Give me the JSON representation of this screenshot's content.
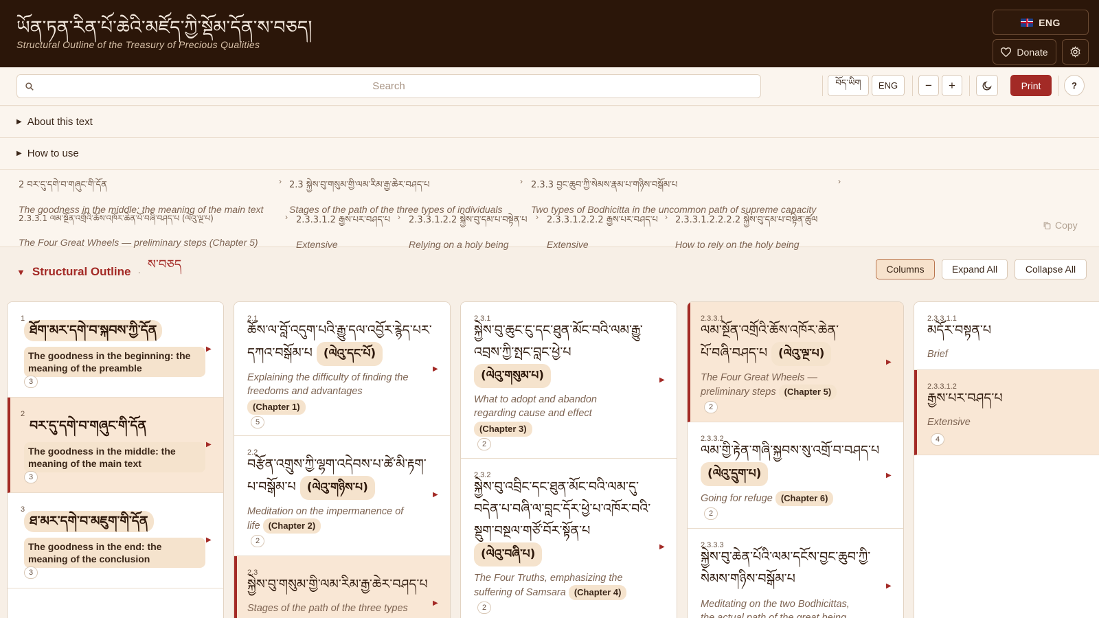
{
  "header": {
    "title_tibetan": "ཡོན་ཏན་རིན་པོ་ཆེའི་མཛོད་ཀྱི་སྡོམ་དོན་ས་བཅད།",
    "subtitle": "Structural Outline of the Treasury of Precious Qualities",
    "lang_button": "ENG",
    "donate_label": "Donate",
    "flag_icon": "uk-flag-icon"
  },
  "toolbar": {
    "search_placeholder": "Search",
    "tibetan_btn": "བོད་ཡིག",
    "english_btn": "ENG",
    "zoom_out": "−",
    "zoom_in": "+",
    "print": "Print",
    "help": "?"
  },
  "accordions": {
    "about": "About this text",
    "how_to_use": "How to use"
  },
  "breadcrumb": {
    "row1": [
      {
        "tib": "2 བར་དུ་དགེ་བ་གཞུང་གི་དོན",
        "eng": "The goodness in the middle: the meaning of the main text"
      },
      {
        "tib": "2.3 སྐྱེས་བུ་གསུམ་གྱི་ལམ་རིམ་རྒྱ་ཆེར་བཤད་པ",
        "eng": "Stages of the path of the three types of individuals"
      },
      {
        "tib": "2.3.3 བྱང་ཆུབ་ཀྱི་སེམས་རྣམ་པ་གཉིས་བསྒོམ་པ",
        "eng": "Two types of Bodhicitta in the uncommon path of supreme capacity"
      }
    ],
    "row2": [
      {
        "tib": "2.3.3.1 ལམ་སྔོན་འགྲོའི་ཆོས་འཁོར་ཆེན་པོ་བཞི་བཤད་པ (ལེའུ་ལྔ་པ)",
        "eng": "The Four Great Wheels — preliminary steps (Chapter 5)"
      },
      {
        "tib": "2.3.3.1.2 རྒྱས་པར་བཤད་པ",
        "eng": "Extensive"
      },
      {
        "tib": "2.3.3.1.2.2 སྐྱེས་བུ་དམ་པ་བསྟེན་པ",
        "eng": "Relying on a holy being"
      },
      {
        "tib": "2.3.3.1.2.2.2 རྒྱས་པར་བཤད་པ",
        "eng": "Extensive"
      },
      {
        "tib": "2.3.3.1.2.2.2.2 སྐྱེས་བུ་དམ་པ་བསྟེན་ཚུལ",
        "eng": "How to rely on the holy being"
      }
    ],
    "copy": "Copy"
  },
  "section": {
    "title": "Structural Outline",
    "tibetan": "ས་བཅད",
    "columns_btn": "Columns",
    "expand_btn": "Expand All",
    "collapse_btn": "Collapse All"
  },
  "col1": [
    {
      "num": "1",
      "tib": "ཐོག་མར་དགེ་བ་སྐབས་ཀྱི་དོན",
      "eng": "The goodness in the beginning: the meaning of the preamble",
      "count": "3"
    },
    {
      "num": "2",
      "tib": "བར་དུ་དགེ་བ་གཞུང་གི་དོན",
      "eng": "The goodness in the middle: the meaning of the main text",
      "count": "3"
    },
    {
      "num": "3",
      "tib": "ཐ་མར་དགེ་བ་མཇུག་གི་དོན",
      "eng": "The goodness in the end: the meaning of the conclusion",
      "count": "3"
    }
  ],
  "col2": [
    {
      "num": "2.1",
      "tib1": "ཆོས་ལ་བློ་འདུག་པའི་རྒྱུ་དལ་འབྱོར་རྙེད་པར་",
      "tib2": "དཀའ་བསྒོམ་པ",
      "pill": "(ལེའུ་དང་པོ)",
      "eng1": "Explaining the difficulty of finding the",
      "eng2": "freedoms and advantages",
      "chap": "(Chapter 1)",
      "count": "5"
    },
    {
      "num": "2.2",
      "tib1": "བརྩོན་འགྲུས་ཀྱི་ལྷག་འདེབས་པ་ཚེ་མི་རྟག་",
      "tib2": "པ་བསྒོམ་པ",
      "pill": "(ལེའུ་གཉིས་པ)",
      "eng1": "Meditation on the impermanence of",
      "eng2": "life",
      "chap": "(Chapter 2)",
      "count": "2"
    },
    {
      "num": "2.3",
      "tib1": "སྐྱེས་བུ་གསུམ་གྱི་ལམ་རིམ་རྒྱ་ཆེར་བཤད་པ",
      "eng1": "Stages of the path of the three types"
    }
  ],
  "col3": [
    {
      "num": "2.3.1",
      "tib1": "སྐྱེས་བུ་ཆུང་ངུ་དང་ཐུན་མོང་བའི་ལམ་རྒྱུ་",
      "tib2": "འབྲས་ཀྱི་སྤང་བླང་ཕྱེ་པ",
      "pill": "(ལེའུ་གསུམ་པ)",
      "eng1": "What to adopt and abandon",
      "eng2": "regarding cause and effect",
      "chap": "(Chapter 3)",
      "count": "2"
    },
    {
      "num": "2.3.2",
      "tib1": "སྐྱེས་བུ་འབྲིང་དང་ཐུན་མོང་བའི་ལམ་དུ་",
      "tib2": "བདེན་པ་བཞི་ལ་བླང་དོར་ཕྱེ་པ་འཁོར་བའི་",
      "tib3": "སྡུག་བསྔལ་གཙོ་བོར་སྟོན་པ",
      "pill": "(ལེའུ་བཞི་པ)",
      "eng1": "The Four Truths, emphasizing the",
      "eng2": "suffering of Samsara",
      "chap": "(Chapter 4)",
      "count": "2"
    }
  ],
  "col4": [
    {
      "num": "2.3.3.1",
      "tib1": "ལམ་སྔོན་འགྲོའི་ཆོས་འཁོར་ཆེན་",
      "tib2": "པོ་བཞི་བཤད་པ",
      "pill": "(ལེའུ་ལྔ་པ)",
      "eng1": "The Four Great Wheels —",
      "eng2": "preliminary steps",
      "chap": "(Chapter 5)",
      "count": "2"
    },
    {
      "num": "2.3.3.2",
      "tib1": "ལམ་གྱི་རྟེན་གཞི་སྐྱབས་སུ་འགྲོ་བ་བཤད་པ",
      "pill": "(ལེའུ་དྲུག་པ)",
      "eng1": "Going for refuge",
      "chap": "(Chapter 6)",
      "count": "2"
    },
    {
      "num": "2.3.3.3",
      "tib1": "སྐྱེས་བུ་ཆེན་པོའི་ལམ་དངོས་བྱང་ཆུབ་ཀྱི་",
      "tib2": "སེམས་གཉིས་བསྒོམ་པ",
      "eng1": "Meditating on the two Bodhicittas,",
      "eng2": "the actual path of the great being"
    }
  ],
  "col5": [
    {
      "num": "2.3.3.1.1",
      "tib1": "མདོར་བསྟན་པ",
      "eng1": "Brief"
    },
    {
      "num": "2.3.3.1.2",
      "tib1": "རྒྱས་པར་བཤད་པ",
      "eng1": "Extensive",
      "count": "4"
    }
  ],
  "colors": {
    "accent": "#a32a26",
    "header_bg": "#2b1609",
    "page_bg": "#f7efe6",
    "selected_bg": "#f9e7d5"
  }
}
